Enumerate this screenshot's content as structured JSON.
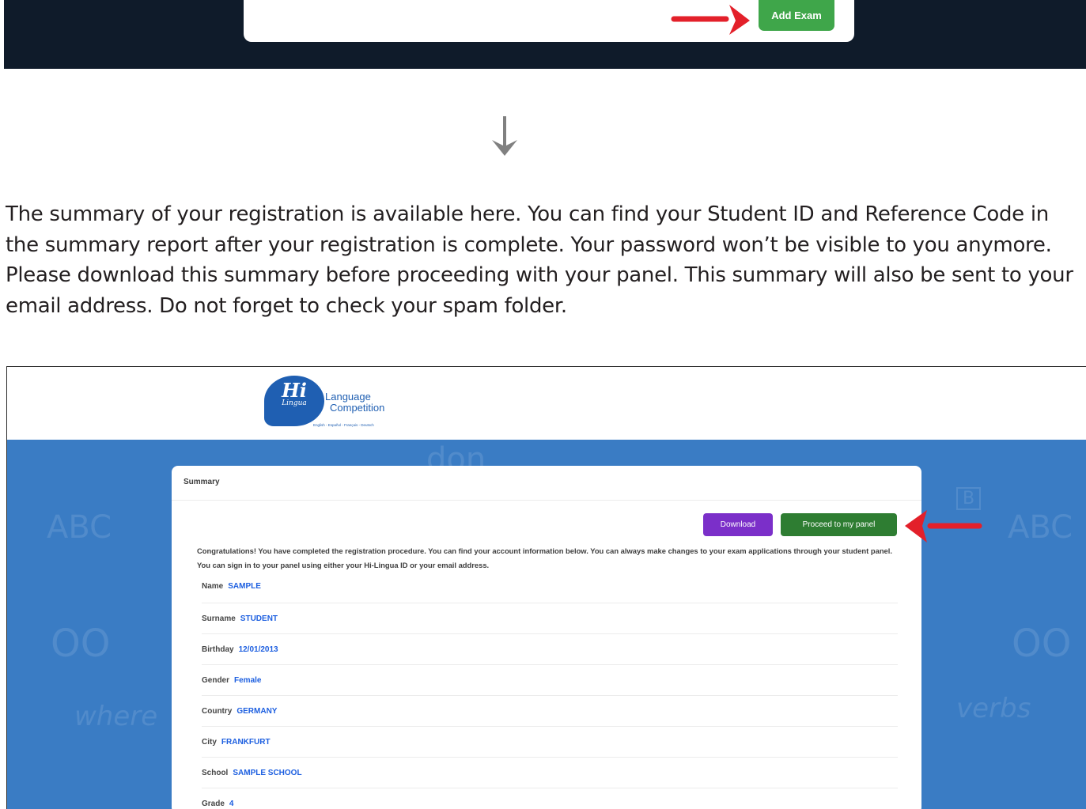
{
  "top": {
    "add_exam_label": "Add Exam"
  },
  "instruction": "The summary of your registration is available here. You can find your Student ID and Reference Code in the summary report after your registration is complete. Your password won’t be visible to you anymore. Please download this summary before proceeding with your panel. This summary will also be sent to your email address. Do not forget to check your spam folder.",
  "logo": {
    "hi": "Hi",
    "lingua": "Lingua",
    "line1": "Language",
    "line2": "Competition",
    "tagline": "English - Español - Français - Deutsch"
  },
  "summary": {
    "title": "Summary",
    "download_label": "Download",
    "proceed_label": "Proceed to my panel",
    "congrats": "Congratulations! You have completed the registration procedure. You can find your account information below. You can always make changes to your exam applications through your student panel. You can sign in to your panel using either your Hi-Lingua ID or your email address.",
    "fields": [
      {
        "label": "Name",
        "value": "SAMPLE"
      },
      {
        "label": "Surname",
        "value": "STUDENT"
      },
      {
        "label": "Birthday",
        "value": "12/01/2013"
      },
      {
        "label": "Gender",
        "value": "Female"
      },
      {
        "label": "Country",
        "value": "GERMANY"
      },
      {
        "label": "City",
        "value": "FRANKFURT"
      },
      {
        "label": "School",
        "value": "SAMPLE SCHOOL"
      },
      {
        "label": "Grade",
        "value": "4"
      }
    ]
  },
  "colors": {
    "arrow_red": "#e3202a",
    "panel_blue": "#3a7cc4",
    "value_blue": "#1d5fe0",
    "download_purple": "#7b2fc9",
    "proceed_green": "#2e7d32",
    "add_exam_green": "#3fa64a"
  }
}
